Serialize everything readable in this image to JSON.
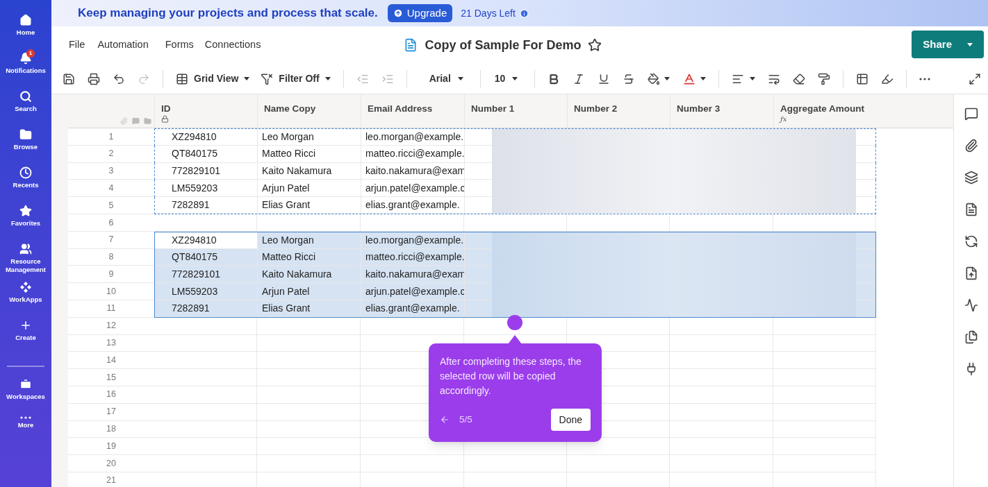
{
  "sidebar": {
    "items": [
      {
        "label": "Home",
        "kind": "home"
      },
      {
        "label": "Notifications",
        "kind": "bell",
        "badge": "1"
      },
      {
        "label": "Search",
        "kind": "search"
      },
      {
        "label": "Browse",
        "kind": "folder"
      },
      {
        "label": "Recents",
        "kind": "clock"
      },
      {
        "label": "Favorites",
        "kind": "star"
      },
      {
        "label": "Resource Management",
        "kind": "people"
      },
      {
        "label": "WorkApps",
        "kind": "apps"
      },
      {
        "label": "Create",
        "kind": "plus"
      },
      {
        "label": "Workspaces",
        "kind": "workspace"
      },
      {
        "label": "More",
        "kind": "more"
      }
    ]
  },
  "banner": {
    "message": "Keep managing your projects and process that scale.",
    "upgrade_button": "Upgrade",
    "days_left": "21 Days Left"
  },
  "menu": [
    "File",
    "Automation",
    "Forms",
    "Connections"
  ],
  "document": {
    "title": "Copy of Sample For Demo",
    "starred": false
  },
  "share_button": "Share",
  "toolbar": {
    "view": "Grid View",
    "filter": "Filter Off",
    "font": "Arial",
    "size": "10"
  },
  "table": {
    "columns": [
      {
        "label": "ID",
        "kind": "locked"
      },
      {
        "label": "Name Copy",
        "kind": "text"
      },
      {
        "label": "Email Address",
        "kind": "text"
      },
      {
        "label": "Number 1",
        "kind": "text"
      },
      {
        "label": "Number 2",
        "kind": "text"
      },
      {
        "label": "Number 3",
        "kind": "text"
      },
      {
        "label": "Aggregate Amount",
        "kind": "formula",
        "symbol": "ƒx"
      }
    ],
    "rows": [
      {
        "number": "1",
        "cells": [
          "XZ294810",
          "Leo Morgan",
          "leo.morgan@example."
        ],
        "copied": true,
        "selected": false,
        "blurred": true
      },
      {
        "number": "2",
        "cells": [
          "QT840175",
          "Matteo Ricci",
          "matteo.ricci@example."
        ],
        "copied": true,
        "selected": false,
        "blurred": true
      },
      {
        "number": "3",
        "cells": [
          "772829101",
          "Kaito Nakamura",
          "kaito.nakamura@exam"
        ],
        "copied": true,
        "selected": false,
        "blurred": true
      },
      {
        "number": "4",
        "cells": [
          "LM559203",
          "Arjun Patel",
          "arjun.patel@example.c"
        ],
        "copied": true,
        "selected": false,
        "blurred": true
      },
      {
        "number": "5",
        "cells": [
          "7282891",
          "Elias Grant",
          "elias.grant@example."
        ],
        "copied": true,
        "selected": false,
        "blurred": true
      },
      {
        "number": "6",
        "copied": false,
        "selected": false,
        "blurred": false
      },
      {
        "number": "7",
        "cells": [
          "XZ294810",
          "Leo Morgan",
          "leo.morgan@example."
        ],
        "copied": false,
        "selected": true,
        "active": true,
        "blurred": true
      },
      {
        "number": "8",
        "cells": [
          "QT840175",
          "Matteo Ricci",
          "matteo.ricci@example."
        ],
        "copied": false,
        "selected": true,
        "active": false,
        "blurred": true
      },
      {
        "number": "9",
        "cells": [
          "772829101",
          "Kaito Nakamura",
          "kaito.nakamura@exam"
        ],
        "copied": false,
        "selected": true,
        "active": false,
        "blurred": true
      },
      {
        "number": "10",
        "cells": [
          "LM559203",
          "Arjun Patel",
          "arjun.patel@example.c"
        ],
        "copied": false,
        "selected": true,
        "active": false,
        "blurred": true
      },
      {
        "number": "11",
        "cells": [
          "7282891",
          "Elias Grant",
          "elias.grant@example."
        ],
        "copied": false,
        "selected": true,
        "active": false,
        "blurred": true
      },
      {
        "number": "12",
        "copied": false,
        "selected": false
      },
      {
        "number": "13",
        "copied": false,
        "selected": false
      },
      {
        "number": "14",
        "copied": false,
        "selected": false
      },
      {
        "number": "15",
        "copied": false,
        "selected": false
      },
      {
        "number": "16",
        "copied": false,
        "selected": false
      },
      {
        "number": "17",
        "copied": false,
        "selected": false
      },
      {
        "number": "18",
        "copied": false,
        "selected": false
      },
      {
        "number": "19",
        "copied": false,
        "selected": false
      },
      {
        "number": "20",
        "copied": false,
        "selected": false
      },
      {
        "number": "21",
        "copied": false,
        "selected": false
      }
    ]
  },
  "tour": {
    "text": "After completing these steps, the selected row will be copied accordingly.",
    "step": "5/5",
    "done_button": "Done"
  }
}
